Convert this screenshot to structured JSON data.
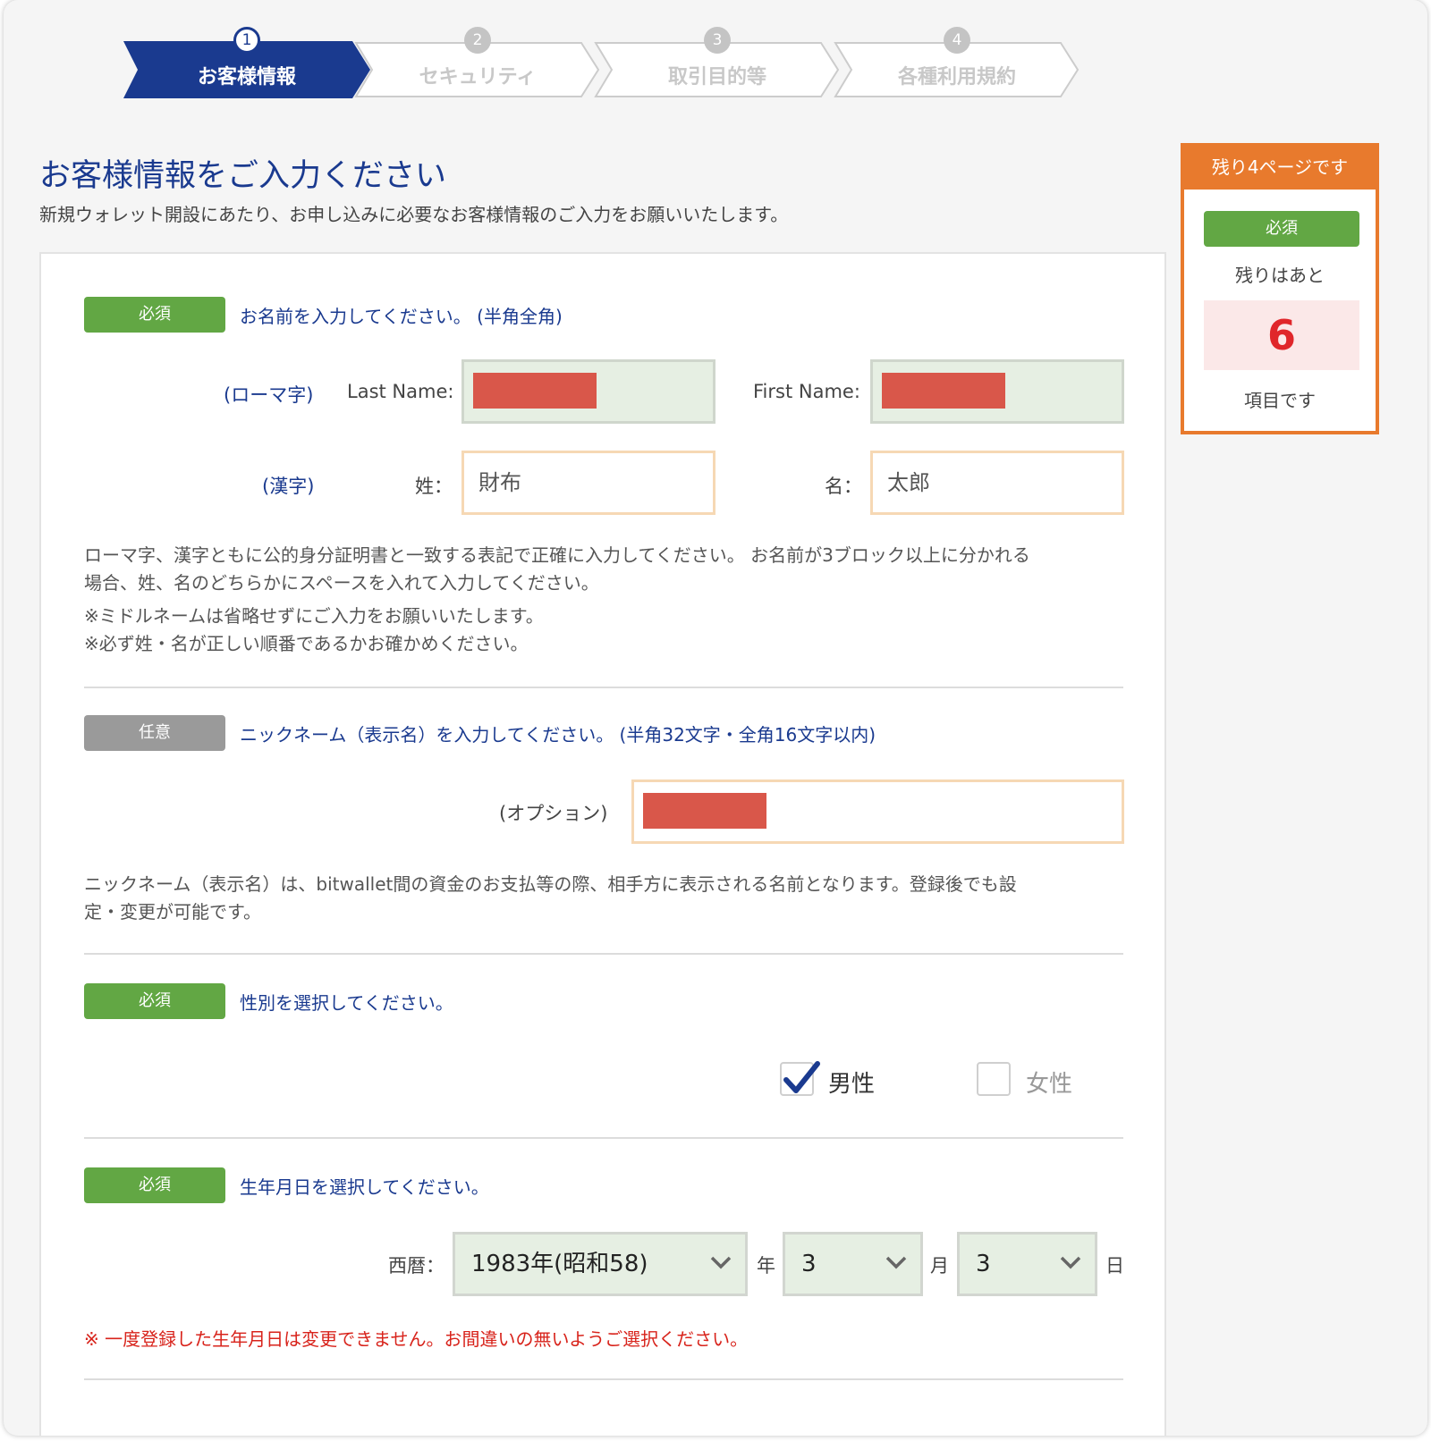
{
  "steps": [
    {
      "num": "1",
      "label": "お客様情報",
      "active": true
    },
    {
      "num": "2",
      "label": "セキュリティ",
      "active": false
    },
    {
      "num": "3",
      "label": "取引目的等",
      "active": false
    },
    {
      "num": "4",
      "label": "各種利用規約",
      "active": false
    }
  ],
  "header": {
    "title": "お客様情報をご入力ください",
    "subtitle": "新規ウォレット開設にあたり、お申し込みに必要なお客様情報のご入力をお願いいたします。"
  },
  "side": {
    "head": "残り4ページです",
    "badge": "必須",
    "remain_label": "残りはあと",
    "count": "6",
    "items_label": "項目です"
  },
  "name_section": {
    "badge": "必須",
    "question": "お名前を入力してください。 (半角全角)",
    "romaji_label": "(ローマ字)",
    "last_name_label": "Last Name:",
    "first_name_label": "First Name:",
    "kanji_label": "(漢字)",
    "sei_label": "姓：",
    "sei_value": "財布",
    "mei_label": "名：",
    "mei_value": "太郎",
    "note1": "ローマ字、漢字ともに公的身分証明書と一致する表記で正確に入力してください。 お名前が3ブロック以上に分かれる",
    "note1b": "場合、姓、名のどちらかにスペースを入れて入力してください。",
    "note2": "※ミドルネームは省略せずにご入力をお願いいたします。",
    "note3": "※必ず姓・名が正しい順番であるかお確かめください。"
  },
  "nickname_section": {
    "badge": "任意",
    "question": "ニックネーム（表示名）を入力してください。 (半角32文字・全角16文字以内)",
    "option_label": "(オプション)",
    "note1": "ニックネーム（表示名）は、bitwallet間の資金のお支払等の際、相手方に表示される名前となります。登録後でも設",
    "note1b": "定・変更が可能です。"
  },
  "gender_section": {
    "badge": "必須",
    "question": "性別を選択してください。",
    "male_label": "男性",
    "female_label": "女性",
    "male_checked": true,
    "female_checked": false
  },
  "birth_section": {
    "badge": "必須",
    "question": "生年月日を選択してください。",
    "era_label": "西暦：",
    "year_value": "1983年(昭和58)",
    "year_unit": "年",
    "month_value": "3",
    "month_unit": "月",
    "day_value": "3",
    "day_unit": "日",
    "warning": "※ 一度登録した生年月日は変更できません。お間違いの無いようご選択ください。"
  },
  "colors": {
    "accent_blue": "#1a3a8f",
    "required_green": "#62a744",
    "optional_gray": "#9a9a9a",
    "side_orange": "#e87a2d",
    "warning_red": "#d8231b"
  }
}
